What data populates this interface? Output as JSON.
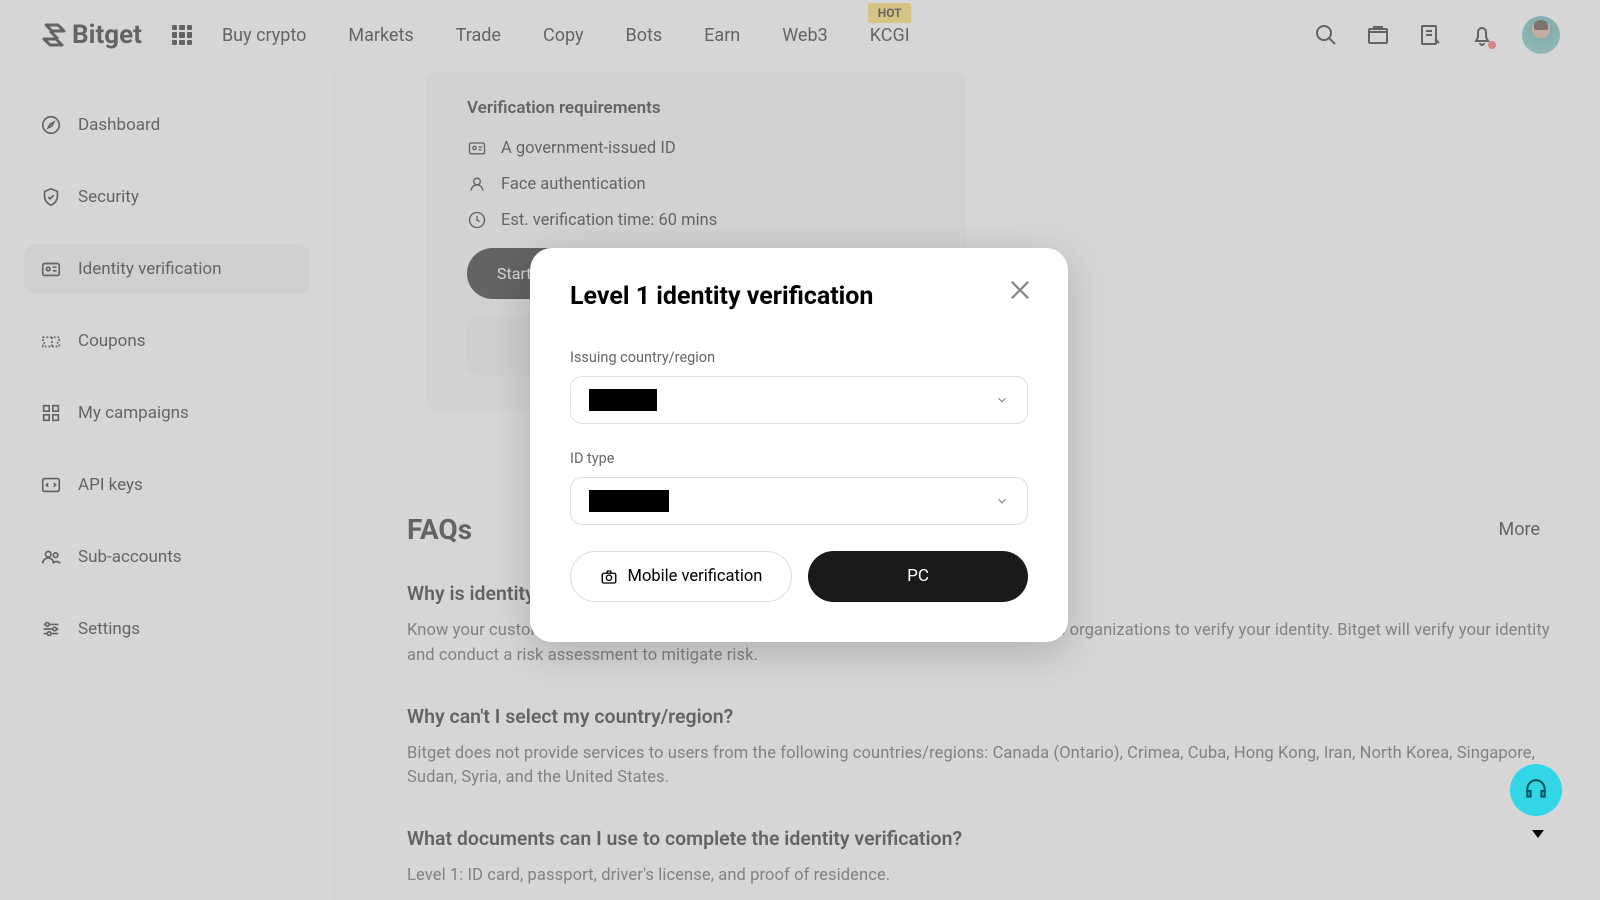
{
  "header": {
    "brand": "Bitget",
    "nav": [
      "Buy crypto",
      "Markets",
      "Trade",
      "Copy",
      "Bots",
      "Earn",
      "Web3",
      "KCGI"
    ],
    "hot_badge": "HOT"
  },
  "sidebar": {
    "items": [
      {
        "label": "Dashboard",
        "icon": "compass-icon"
      },
      {
        "label": "Security",
        "icon": "shield-icon"
      },
      {
        "label": "Identity verification",
        "icon": "id-card-icon"
      },
      {
        "label": "Coupons",
        "icon": "ticket-icon"
      },
      {
        "label": "My campaigns",
        "icon": "grid-icon"
      },
      {
        "label": "API keys",
        "icon": "code-icon"
      },
      {
        "label": "Sub-accounts",
        "icon": "users-icon"
      },
      {
        "label": "Settings",
        "icon": "sliders-icon"
      }
    ],
    "active_index": 2
  },
  "card": {
    "title": "Verification requirements",
    "req1": "A government-issued ID",
    "req2": "Face authentication",
    "req3": "Est. verification time: 60 mins",
    "start": "Start"
  },
  "faqs": {
    "heading": "FAQs",
    "more": "More",
    "items": [
      {
        "q": "Why is identity verification required?",
        "a": "Know your customer (KYC) is a process used by financial institutions and other regulated organizations to verify your identity. Bitget will verify your identity and conduct a risk assessment to mitigate risk."
      },
      {
        "q": "Why can't I select my country/region?",
        "a": "Bitget does not provide services to users from the following countries/regions: Canada (Ontario), Crimea, Cuba, Hong Kong, Iran, North Korea, Singapore, Sudan, Syria, and the United States."
      },
      {
        "q": "What documents can I use to complete the identity verification?",
        "a": "Level 1: ID card, passport, driver's license, and proof of residence."
      }
    ]
  },
  "modal": {
    "title": "Level 1 identity verification",
    "label_country": "Issuing country/region",
    "label_idtype": "ID type",
    "mobile_btn": "Mobile verification",
    "pc_btn": "PC"
  }
}
